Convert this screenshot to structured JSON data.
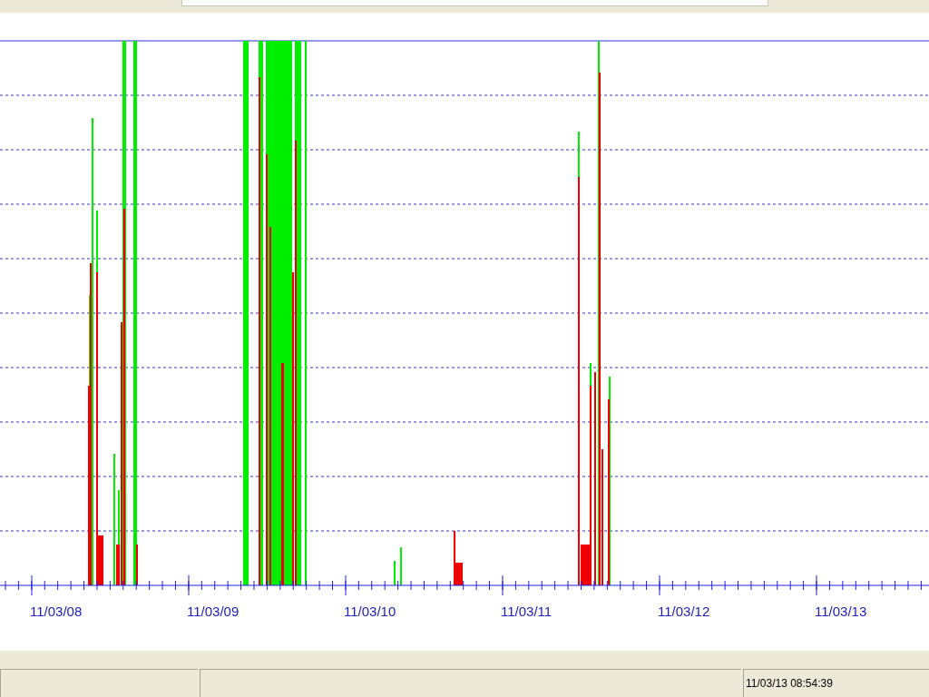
{
  "chart": {
    "x_labels": [
      "11/03/08",
      "11/03/09",
      "11/03/10",
      "11/03/11",
      "11/03/12",
      "11/03/13"
    ]
  },
  "status_bar": {
    "timestamp": "11/03/13 08:54:39"
  }
}
